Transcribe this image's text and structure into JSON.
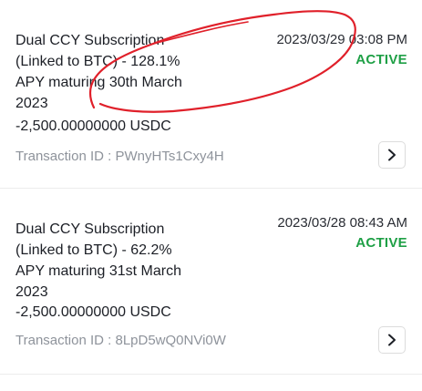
{
  "transactions": [
    {
      "title": "Dual CCY Subscription\n(Linked to BTC) - 128.1%\nAPY maturing 30th March\n2023",
      "amount": "-2,500.00000000 USDC",
      "datetime": "2023/03/29 03:08 PM",
      "status": "ACTIVE",
      "transaction_id_label": "Transaction ID : PWnyHTs1Cxy4H",
      "action_icon": "chevron-right-icon"
    },
    {
      "title": "Dual CCY Subscription\n(Linked to BTC) - 62.2%\nAPY maturing 31st March\n2023",
      "amount": "-2,500.00000000 USDC",
      "datetime": "2023/03/28 08:43 AM",
      "status": "ACTIVE",
      "transaction_id_label": "Transaction ID : 8LpD5wQ0NVi0W",
      "action_icon": "chevron-right-icon"
    }
  ],
  "colors": {
    "status_active": "#1fa046",
    "annotation": "#e0202a",
    "muted_text": "#8e939b"
  }
}
